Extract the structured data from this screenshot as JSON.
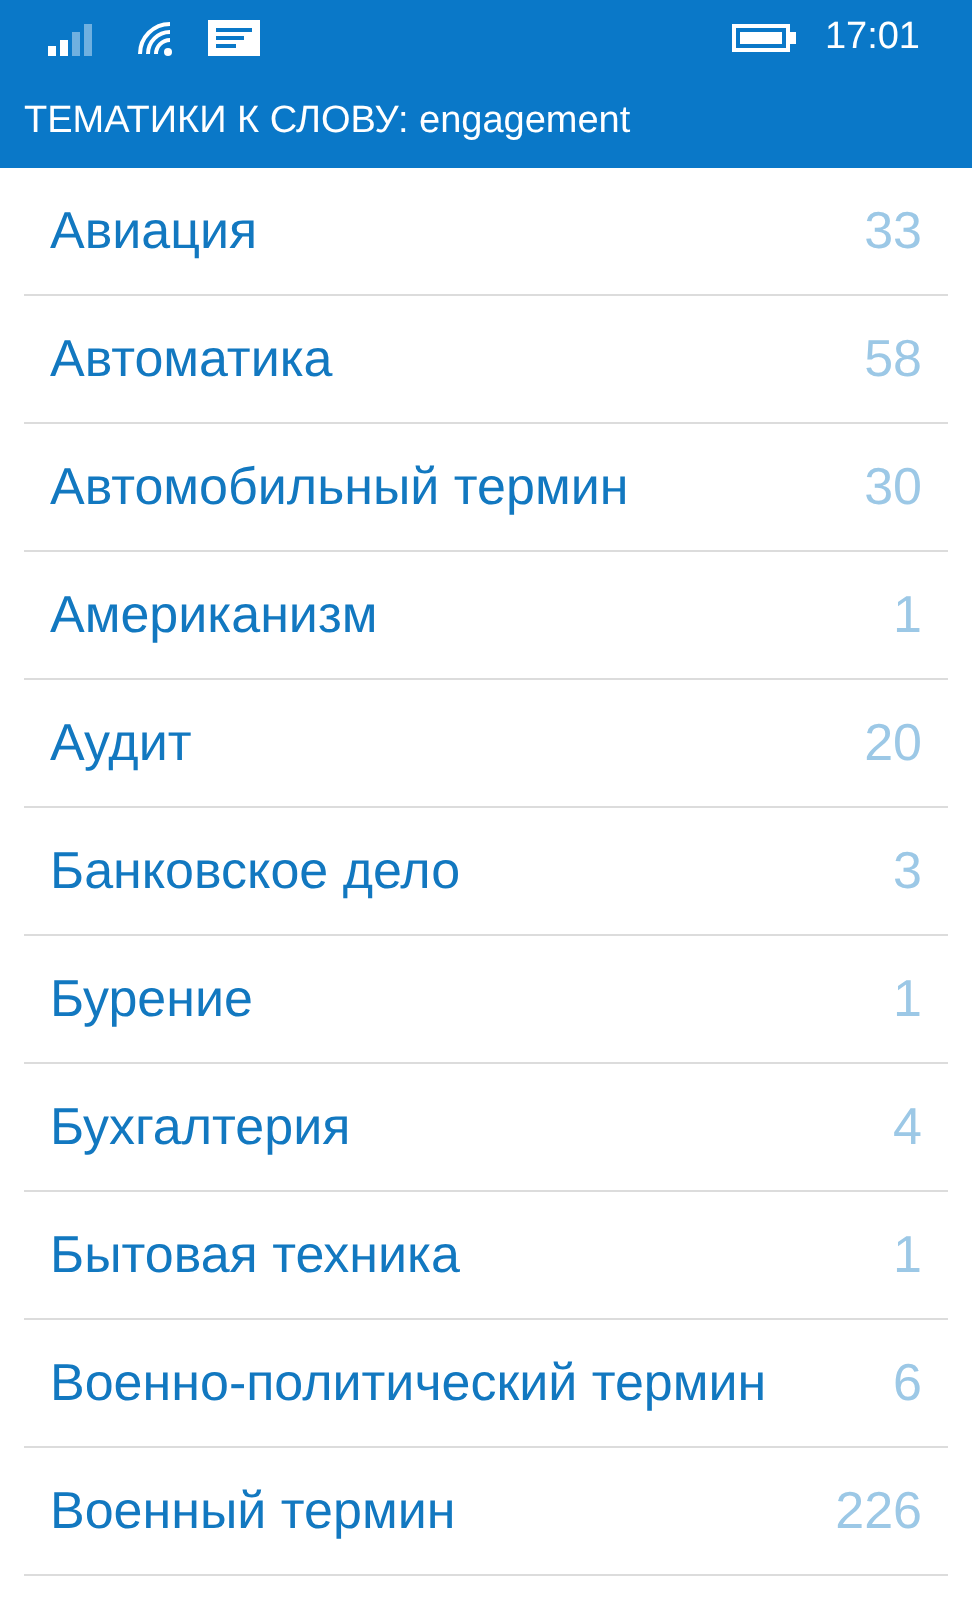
{
  "status_bar": {
    "time": "17:01"
  },
  "header": {
    "title": "ТЕМАТИКИ К СЛОВУ: engagement"
  },
  "topics": [
    {
      "name": "Авиация",
      "count": "33"
    },
    {
      "name": "Автоматика",
      "count": "58"
    },
    {
      "name": "Автомобильный термин",
      "count": "30"
    },
    {
      "name": "Американизм",
      "count": "1"
    },
    {
      "name": "Аудит",
      "count": "20"
    },
    {
      "name": "Банковское дело",
      "count": "3"
    },
    {
      "name": "Бурение",
      "count": "1"
    },
    {
      "name": "Бухгалтерия",
      "count": "4"
    },
    {
      "name": "Бытовая техника",
      "count": "1"
    },
    {
      "name": "Военно-политический термин",
      "count": "6"
    },
    {
      "name": "Военный термин",
      "count": "226"
    }
  ]
}
